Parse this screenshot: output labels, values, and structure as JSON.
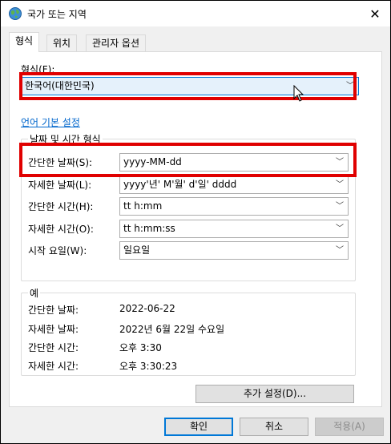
{
  "window": {
    "title": "국가 또는 지역",
    "close_label": "✕"
  },
  "tabs": [
    {
      "label": "형식"
    },
    {
      "label": "위치"
    },
    {
      "label": "관리자 옵션"
    }
  ],
  "format": {
    "label": "형식(F):",
    "value": "한국어(대한민국)"
  },
  "language_link": "언어 기본 설정",
  "datetime_group": {
    "title": "날짜 및 시간 형식",
    "rows": [
      {
        "label": "간단한 날짜(S):",
        "value": "yyyy-MM-dd"
      },
      {
        "label": "자세한 날짜(L):",
        "value": "yyyy'년' M'월' d'일' dddd"
      },
      {
        "label": "간단한 시간(H):",
        "value": "tt h:mm"
      },
      {
        "label": "자세한 시간(O):",
        "value": "tt h:mm:ss"
      },
      {
        "label": "시작 요일(W):",
        "value": "일요일"
      }
    ]
  },
  "example_group": {
    "title": "예",
    "rows": [
      {
        "label": "간단한 날짜:",
        "value": "2022-06-22"
      },
      {
        "label": "자세한 날짜:",
        "value": "2022년 6월 22일 수요일"
      },
      {
        "label": "간단한 시간:",
        "value": "오후 3:30"
      },
      {
        "label": "자세한 시간:",
        "value": "오후 3:30:23"
      }
    ]
  },
  "buttons": {
    "additional": "추가 설정(D)...",
    "ok": "확인",
    "cancel": "취소",
    "apply": "적용(A)"
  },
  "colors": {
    "highlight": "#e00000",
    "link": "#0066cc",
    "accent": "#0078d7"
  }
}
